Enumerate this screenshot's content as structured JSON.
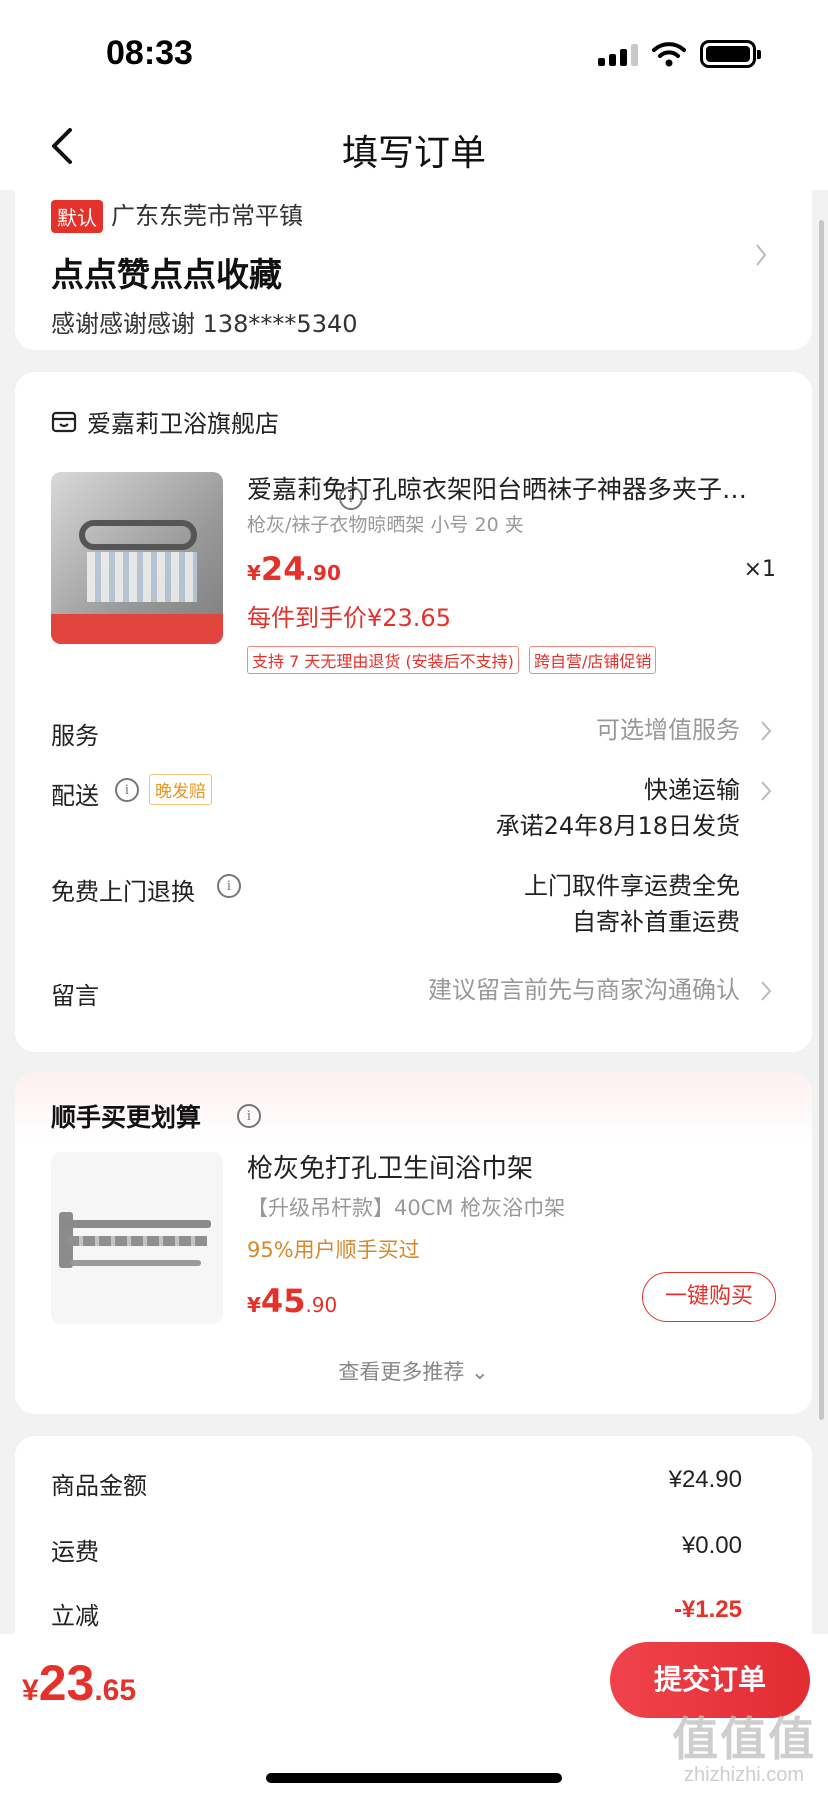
{
  "status": {
    "time": "08:33"
  },
  "nav": {
    "title": "填写订单"
  },
  "address": {
    "default_tag": "默认",
    "region": "广东东莞市常平镇",
    "line": "点点赞点点收藏",
    "contact": "感谢感谢感谢  138****5340"
  },
  "store": {
    "name": "爱嘉莉卫浴旗舰店"
  },
  "product": {
    "title": "爱嘉莉免打孔晾衣架阳台晒袜子神器多夹子…",
    "spec": "枪灰/袜子衣物晾晒架 小号 20 夹",
    "price_symbol": "¥",
    "price_int": "24",
    "price_dec": ".90",
    "qty": "×1",
    "unit_price": "每件到手价¥23.65",
    "tags": [
      "支持 7 天无理由退货 (安装后不支持)",
      "跨自营/店铺促销"
    ]
  },
  "rows": {
    "service_label": "服务",
    "service_value": "可选增值服务",
    "delivery_label": "配送",
    "delivery_tag": "晚发赔",
    "delivery_value1": "快递运输",
    "delivery_value2": "承诺24年8月18日发货",
    "return_label": "免费上门退换",
    "return_value1": "上门取件享运费全免",
    "return_value2": "自寄补首重运费",
    "message_label": "留言",
    "message_value": "建议留言前先与商家沟通确认"
  },
  "recommend": {
    "title": "顺手买更划算",
    "name": "枪灰免打孔卫生间浴巾架",
    "spec": "【升级吊杆款】40CM 枪灰浴巾架",
    "hint": "95%用户顺手买过",
    "price_symbol": "¥",
    "price_int": "45",
    "price_dec": ".90",
    "buy_label": "一键购买",
    "more_label": "查看更多推荐 ⌄"
  },
  "summary": {
    "goods_label": "商品金额",
    "goods_value": "¥24.90",
    "shipping_label": "运费",
    "shipping_value": "¥0.00",
    "discount_label": "立减",
    "discount_value": "-¥1.25"
  },
  "bottom": {
    "total_symbol": "¥",
    "total_int": "23",
    "total_dec": ".65",
    "submit_label": "提交订单"
  },
  "watermark": {
    "big": "值值值",
    "small": "zhizhizhi.com"
  },
  "colors": {
    "accent": "#e6302a",
    "hint": "#d8882a",
    "muted": "#999999"
  }
}
